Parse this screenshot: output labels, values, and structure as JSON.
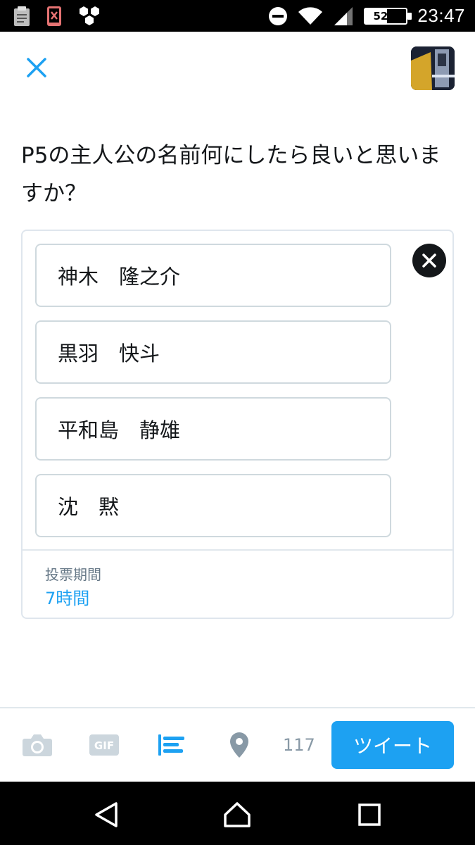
{
  "status_bar": {
    "time": "23:47",
    "battery_percent": "52%",
    "battery_level": 0.52,
    "left_icons": [
      "clipboard-icon",
      "phone-off-icon",
      "hexagons-icon"
    ],
    "right_icons": [
      "do-not-disturb-icon",
      "wifi-icon",
      "signal-icon",
      "battery-icon"
    ]
  },
  "header": {
    "close_icon": "close-icon",
    "avatar": "profile-avatar"
  },
  "tweet": {
    "text": "P5の主人公の名前何にしたら良いと思いますか？"
  },
  "poll": {
    "options": [
      "神木　隆之介",
      "黒羽　快斗",
      "平和島　静雄",
      "沈　黙"
    ],
    "remove_icon": "remove-poll-icon",
    "length_label": "投票期間",
    "length_value": "7時間"
  },
  "toolbar": {
    "icons": [
      "camera-icon",
      "gif-icon",
      "poll-icon",
      "location-icon"
    ],
    "gif_label": "GIF",
    "char_count": "117",
    "tweet_button": "ツイート",
    "accent_color": "#1da1f2"
  },
  "nav_bar": {
    "icons": [
      "back-icon",
      "home-icon",
      "recents-icon"
    ]
  }
}
